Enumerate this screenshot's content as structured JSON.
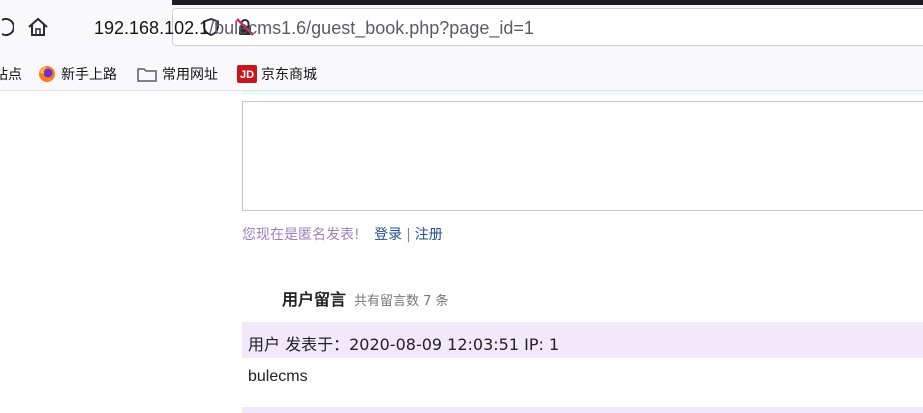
{
  "browser": {
    "url_host": "192.168.102.1",
    "url_path": "/bulecms1.6/guest_book.php?page_id=1",
    "icons": [
      "reload-icon",
      "home-icon",
      "shield-icon",
      "insecure-lock-icon"
    ]
  },
  "bookmarks": [
    {
      "label": "站点",
      "icon": "none"
    },
    {
      "label": "新手上路",
      "icon": "firefox-icon"
    },
    {
      "label": "常用网址",
      "icon": "folder-icon"
    },
    {
      "label": "京东商城",
      "icon": "jd-icon"
    }
  ],
  "form": {
    "anonymous_notice": "您现在是匿名发表!",
    "login_link": "登录",
    "separator": "|",
    "register_link": "注册"
  },
  "messages_section": {
    "title": "用户留言",
    "count_text": "共有留言数 7 条"
  },
  "messages": [
    {
      "meta": "用户 发表于：2020-08-09 12:03:51   IP: 1",
      "body": "bulecms"
    }
  ],
  "colors": {
    "message_header_bg": "#f1e8f9",
    "anon_text": "#a080c0",
    "link": "#1e4f8f"
  }
}
